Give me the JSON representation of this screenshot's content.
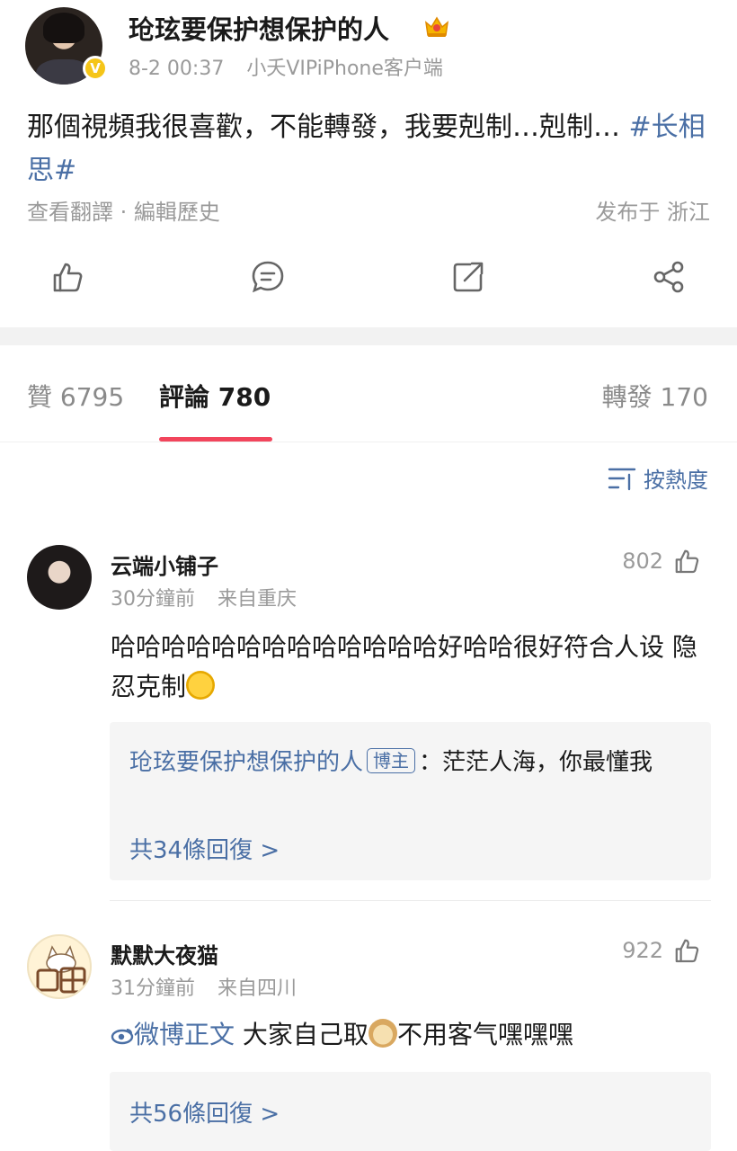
{
  "post": {
    "author_name": "玱玹要保护想保护的人",
    "verified_mark": "V",
    "time": "8-2 00:37",
    "source": "小夭VIPiPhone客户端",
    "text": "那個視頻我很喜歡，不能轉發，我要剋制…剋制… ",
    "hashtag": "#长相思#",
    "translate_link": "查看翻譯",
    "edit_history_link": "編輯歷史",
    "footer_sep": "·",
    "location": "发布于 浙江"
  },
  "actions": [
    "like-icon",
    "comment-icon",
    "repost-icon",
    "share-icon"
  ],
  "tabs": {
    "likes": "贊 6795",
    "comments": "評論 780",
    "reposts": "轉發 170"
  },
  "sort": {
    "label": "按熱度"
  },
  "comments": [
    {
      "name": "云端小铺子",
      "time": "30分鐘前",
      "location": "来自重庆",
      "likes": "802",
      "text": "哈哈哈哈哈哈哈哈哈哈哈哈哈好哈哈很好符合人设 隐忍克制",
      "reply": {
        "author": "玱玹要保护想保护的人",
        "tag": "博主",
        "text": "：茫茫人海，你最懂我",
        "count": "共34條回復 >"
      }
    },
    {
      "name": "默默大夜猫",
      "time": "31分鐘前",
      "location": "来自四川",
      "likes": "922",
      "link_label": "微博正文",
      "text_a": "大家自己取",
      "text_b": "不用客气嘿嘿嘿",
      "reply": {
        "count": "共56條回復 >"
      }
    }
  ],
  "colors": {
    "link": "#4a6fa5",
    "tab_underline": "#f2455c",
    "verified": "#f5c518"
  }
}
